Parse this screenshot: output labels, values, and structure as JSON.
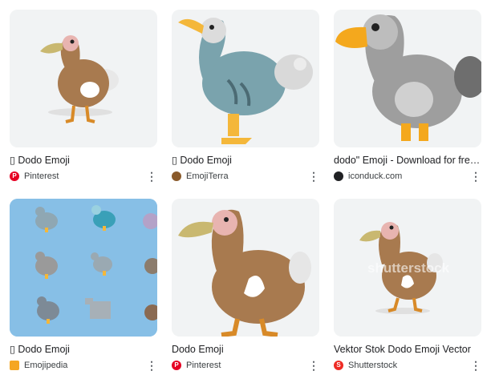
{
  "results": [
    {
      "title": "▯ Dodo Emoji",
      "source": "Pinterest",
      "source_icon": "pinterest-icon",
      "icon_color": "#e60023",
      "icon_glyph": "P",
      "more_label": "⋮"
    },
    {
      "title": "▯ Dodo Emoji",
      "source": "EmojiTerra",
      "source_icon": "emojiterra-icon",
      "icon_color": "#8a5a2b",
      "icon_glyph": "",
      "more_label": "⋮"
    },
    {
      "title": "dodo\" Emoji - Download for free – Iconduck",
      "source": "iconduck.com",
      "source_icon": "iconduck-icon",
      "icon_color": "#202124",
      "icon_glyph": "",
      "more_label": "⋮"
    },
    {
      "title": "▯ Dodo Emoji",
      "source": "Emojipedia",
      "source_icon": "emojipedia-icon",
      "icon_color": "#f5a623",
      "icon_glyph": "",
      "more_label": "⋮"
    },
    {
      "title": "Dodo Emoji",
      "source": "Pinterest",
      "source_icon": "pinterest-icon",
      "icon_color": "#e60023",
      "icon_glyph": "P",
      "more_label": "⋮"
    },
    {
      "title": "Vektor Stok Dodo Emoji Vector",
      "source": "Shutterstock",
      "source_icon": "shutterstock-icon",
      "icon_color": "#ee2b24",
      "icon_glyph": "S",
      "more_label": "⋮"
    }
  ],
  "watermark": "shutterstock"
}
